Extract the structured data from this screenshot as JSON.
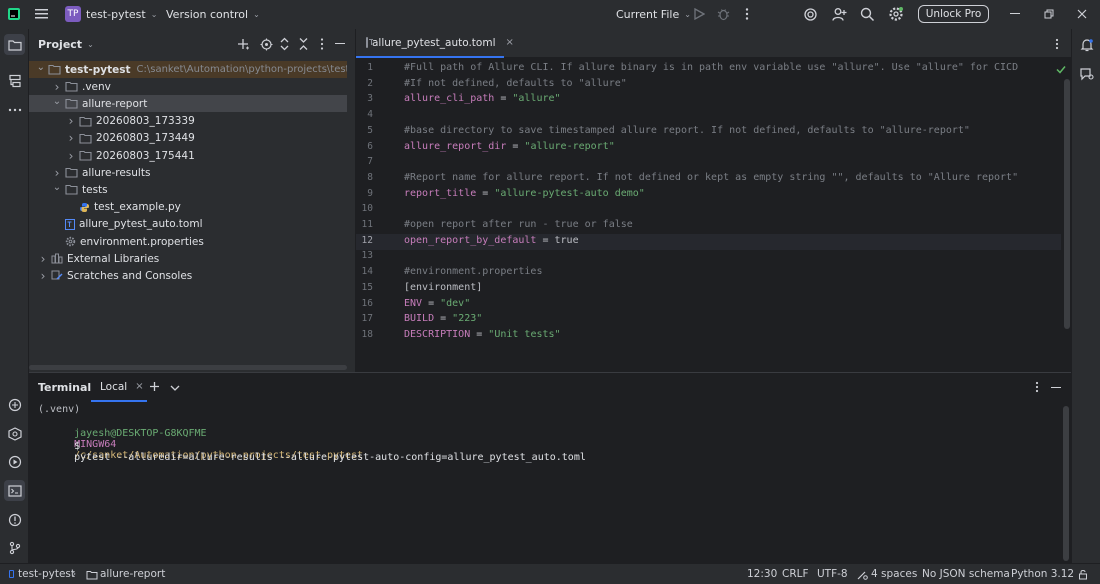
{
  "titlebar": {
    "project_badge": "TP",
    "project_name": "test-pytest",
    "vcs": "Version control",
    "run_config": "Current File",
    "unlock": "Unlock Pro"
  },
  "project_panel": {
    "title": "Project",
    "tree": [
      {
        "label": "test-pytest",
        "extra": "C:\\sanket\\Automation\\python-projects\\test-pytest",
        "indent": 0,
        "chev": "v",
        "type": "folder",
        "state": "root"
      },
      {
        "label": ".venv",
        "indent": 1,
        "chev": ">",
        "type": "folder"
      },
      {
        "label": "allure-report",
        "indent": 1,
        "chev": "v",
        "type": "folder",
        "state": "selected"
      },
      {
        "label": "20260803_173339",
        "indent": 2,
        "chev": ">",
        "type": "folder"
      },
      {
        "label": "20260803_173449",
        "indent": 2,
        "chev": ">",
        "type": "folder"
      },
      {
        "label": "20260803_175441",
        "indent": 2,
        "chev": ">",
        "type": "folder"
      },
      {
        "label": "allure-results",
        "indent": 1,
        "chev": ">",
        "type": "folder"
      },
      {
        "label": "tests",
        "indent": 1,
        "chev": "v",
        "type": "folder"
      },
      {
        "label": "test_example.py",
        "indent": 2,
        "chev": "",
        "type": "py"
      },
      {
        "label": "allure_pytest_auto.toml",
        "indent": 1,
        "chev": "",
        "type": "toml"
      },
      {
        "label": "environment.properties",
        "indent": 1,
        "chev": "",
        "type": "gear"
      },
      {
        "label": "External Libraries",
        "indent": 0,
        "chev": ">",
        "type": "lib"
      },
      {
        "label": "Scratches and Consoles",
        "indent": 0,
        "chev": ">",
        "type": "scratch"
      }
    ]
  },
  "editor": {
    "tab_label": "allure_pytest_auto.toml",
    "current_line": 12,
    "lines": [
      [
        {
          "t": "#Full path of Allure CLI. If allure binary is in path env variable use \"allure\". Use \"allure\" for CICD",
          "c": "cmt"
        }
      ],
      [
        {
          "t": "#If not defined, defaults to \"allure\"",
          "c": "cmt"
        }
      ],
      [
        {
          "t": "allure_cli_path",
          "c": "key"
        },
        {
          "t": " = ",
          "c": "plain"
        },
        {
          "t": "\"allure\"",
          "c": "str"
        }
      ],
      [],
      [
        {
          "t": "#base directory to save timestamped allure report. If not defined, defaults to \"allure-report\"",
          "c": "cmt"
        }
      ],
      [
        {
          "t": "allure_report_dir",
          "c": "key"
        },
        {
          "t": " = ",
          "c": "plain"
        },
        {
          "t": "\"allure-report\"",
          "c": "str"
        }
      ],
      [],
      [
        {
          "t": "#Report name for allure report. If not defined or kept as empty string \"\", defaults to \"Allure report\"",
          "c": "cmt"
        }
      ],
      [
        {
          "t": "report_title",
          "c": "key"
        },
        {
          "t": " = ",
          "c": "plain"
        },
        {
          "t": "\"allure-pytest-auto demo\"",
          "c": "str"
        }
      ],
      [],
      [
        {
          "t": "#open report after run - true or false",
          "c": "cmt"
        }
      ],
      [
        {
          "t": "open_report_by_default",
          "c": "key"
        },
        {
          "t": " = ",
          "c": "plain"
        },
        {
          "t": "true",
          "c": "plain"
        }
      ],
      [],
      [
        {
          "t": "#environment.properties",
          "c": "cmt"
        }
      ],
      [
        {
          "t": "[environment]",
          "c": "plain"
        }
      ],
      [
        {
          "t": "ENV",
          "c": "key"
        },
        {
          "t": " = ",
          "c": "plain"
        },
        {
          "t": "\"dev\"",
          "c": "str"
        }
      ],
      [
        {
          "t": "BUILD",
          "c": "key"
        },
        {
          "t": " = ",
          "c": "plain"
        },
        {
          "t": "\"223\"",
          "c": "str"
        }
      ],
      [
        {
          "t": "DESCRIPTION",
          "c": "key"
        },
        {
          "t": " = ",
          "c": "plain"
        },
        {
          "t": "\"Unit tests\"",
          "c": "str"
        }
      ]
    ]
  },
  "terminal": {
    "title": "Terminal",
    "tab": "Local",
    "venv_line": "(.venv)",
    "user": "jayesh@DESKTOP-G8KQFME",
    "shell": "MINGW64",
    "path": "/c/sanket/Automation/python-projects/test-pytest",
    "prompt": "$",
    "command": "pytest --alluredir=allure-results --allure-pytest-auto-config=allure_pytest_auto.toml"
  },
  "statusbar": {
    "crumb_project": "test-pytest",
    "crumb_folder": "allure-report",
    "position": "12:30",
    "line_sep": "CRLF",
    "encoding": "UTF-8",
    "indent": "4 spaces",
    "schema": "No JSON schema",
    "interpreter": "Python 3.12"
  },
  "colors": {
    "accent_badge": "#7c5cbf",
    "folder": "#8c9099",
    "check": "#5fb865"
  }
}
